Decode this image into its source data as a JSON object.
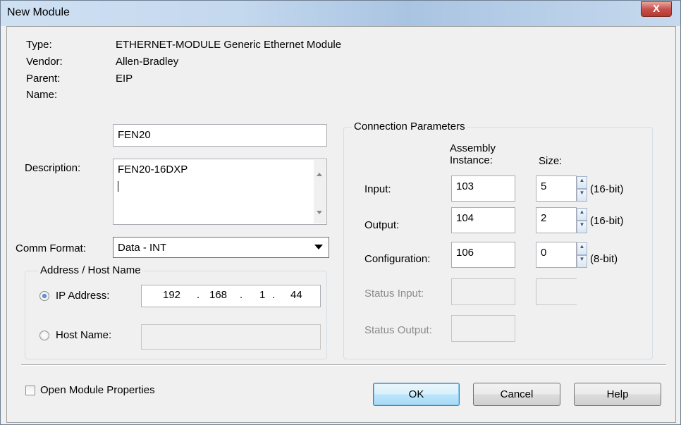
{
  "window": {
    "title": "New Module",
    "close_label": "X"
  },
  "info": {
    "type_label": "Type:",
    "type_value": "ETHERNET-MODULE Generic Ethernet Module",
    "vendor_label": "Vendor:",
    "vendor_value": "Allen-Bradley",
    "parent_label": "Parent:",
    "parent_value": "EIP"
  },
  "name": {
    "label": "Name:",
    "value": "FEN20"
  },
  "description": {
    "label": "Description:",
    "value": "FEN20-16DXP"
  },
  "comm_format": {
    "label": "Comm Format:",
    "selected": "Data - INT"
  },
  "address": {
    "group_title": "Address / Host Name",
    "ip_label": "IP Address:",
    "ip_octets": [
      "192",
      "168",
      "1",
      "44"
    ],
    "ip_separator": ".",
    "host_label": "Host Name:",
    "host_value": "",
    "ip_selected": true
  },
  "connection": {
    "group_title": "Connection Parameters",
    "assembly_header": "Assembly Instance:",
    "size_header": "Size:",
    "rows": [
      {
        "label": "Input:",
        "instance": "103",
        "size": "5",
        "unit": "(16-bit)"
      },
      {
        "label": "Output:",
        "instance": "104",
        "size": "2",
        "unit": "(16-bit)"
      },
      {
        "label": "Configuration:",
        "instance": "106",
        "size": "0",
        "unit": "(8-bit)"
      }
    ],
    "status_input_label": "Status Input:",
    "status_output_label": "Status Output:"
  },
  "footer": {
    "open_props_label": "Open Module Properties",
    "ok_label": "OK",
    "cancel_label": "Cancel",
    "help_label": "Help"
  }
}
